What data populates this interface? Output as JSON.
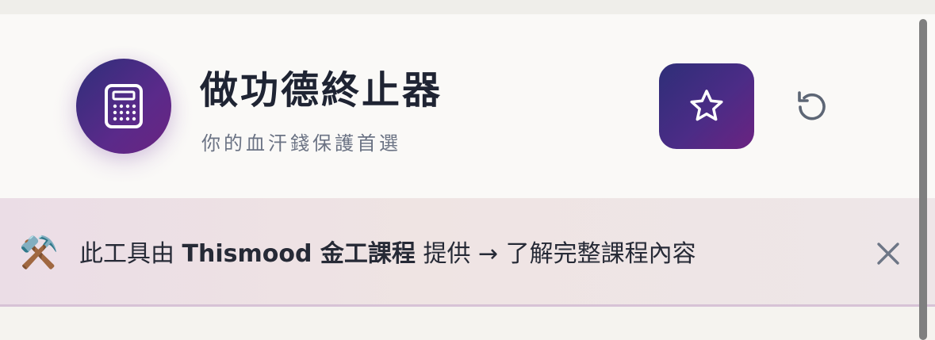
{
  "header": {
    "title": "做功德終止器",
    "subtitle": "你的血汗錢保護首選",
    "logo_icon": "calculator-icon",
    "favorite_icon": "star-icon",
    "reset_icon": "refresh-icon"
  },
  "notice": {
    "emoji": "⚒️",
    "prefix": "此工具由 ",
    "course_name": "Thismood 金工課程",
    "suffix": " 提供 → 了解完整課程內容",
    "close_icon": "close-icon"
  },
  "colors": {
    "brand_gradient_start": "#2e2e78",
    "brand_gradient_end": "#6b2381",
    "title_color": "#1f2433",
    "subtitle_color": "#6b7384"
  }
}
